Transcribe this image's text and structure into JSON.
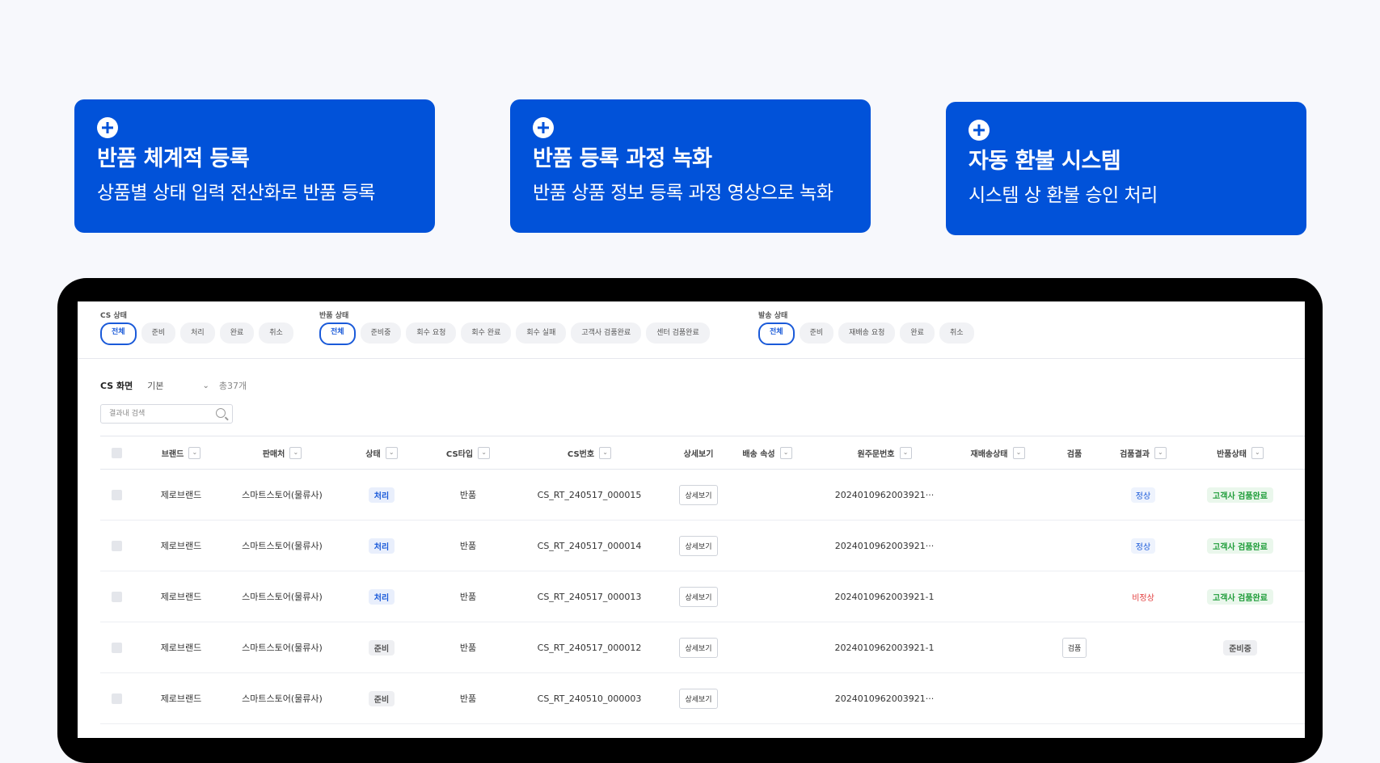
{
  "cards": [
    {
      "title": "반품 체계적 등록",
      "subtitle": "상품별 상태 입력 전산화로 반품 등록"
    },
    {
      "title": "반품 등록 과정 녹화",
      "subtitle": "반품 상품 정보 등록 과정 영상으로 녹화"
    },
    {
      "title": "자동 환불 시스템",
      "subtitle": "시스템 상 환불 승인 처리"
    }
  ],
  "filters": {
    "cs_status": {
      "label": "CS 상태",
      "options": [
        "전체",
        "준비",
        "처리",
        "완료",
        "취소"
      ],
      "selected": "전체"
    },
    "return_status": {
      "label": "반품 상태",
      "options": [
        "전체",
        "준비중",
        "회수 요청",
        "회수 완료",
        "회수 실패",
        "고객사 검품완료",
        "센터 검품완료"
      ],
      "selected": "전체"
    },
    "ship_status": {
      "label": "발송 상태",
      "options": [
        "전체",
        "준비",
        "재배송 요청",
        "완료",
        "취소"
      ],
      "selected": "전체"
    }
  },
  "view": {
    "title": "CS 화면",
    "mode": "기본",
    "total": "총37개"
  },
  "search": {
    "placeholder": "결과내 검색"
  },
  "table": {
    "headers": [
      "브랜드",
      "판매처",
      "상태",
      "CS타입",
      "CS번호",
      "상세보기",
      "배송 속성",
      "원주문번호",
      "재배송상태",
      "검품",
      "검품결과",
      "반품상태"
    ],
    "rows": [
      {
        "brand": "제로브랜드",
        "seller": "스마트스토어(물류사)",
        "status": "처리",
        "cs_type": "반품",
        "cs_no": "CS_RT_240517_000015",
        "detail": "상세보기",
        "order_no": "2024010962003921···",
        "inspect": "",
        "inspect_result": "정상",
        "return_status": "고객사 검품완료"
      },
      {
        "brand": "제로브랜드",
        "seller": "스마트스토어(물류사)",
        "status": "처리",
        "cs_type": "반품",
        "cs_no": "CS_RT_240517_000014",
        "detail": "상세보기",
        "order_no": "2024010962003921···",
        "inspect": "",
        "inspect_result": "정상",
        "return_status": "고객사 검품완료"
      },
      {
        "brand": "제로브랜드",
        "seller": "스마트스토어(물류사)",
        "status": "처리",
        "cs_type": "반품",
        "cs_no": "CS_RT_240517_000013",
        "detail": "상세보기",
        "order_no": "2024010962003921-1",
        "inspect": "",
        "inspect_result": "비정상",
        "return_status": "고객사 검품완료"
      },
      {
        "brand": "제로브랜드",
        "seller": "스마트스토어(물류사)",
        "status": "준비",
        "cs_type": "반품",
        "cs_no": "CS_RT_240517_000012",
        "detail": "상세보기",
        "order_no": "2024010962003921-1",
        "inspect": "검품",
        "inspect_result": "",
        "return_status": "준비중"
      },
      {
        "brand": "제로브랜드",
        "seller": "스마트스토어(물류사)",
        "status": "준비",
        "cs_type": "반품",
        "cs_no": "CS_RT_240510_000003",
        "detail": "상세보기",
        "order_no": "2024010962003921···",
        "inspect": "",
        "inspect_result": "",
        "return_status": ""
      }
    ]
  },
  "colors": {
    "accent": "#0152d9",
    "status_blue": "#1a5ad9",
    "status_green": "#1f9d3a",
    "status_red": "#e23b3b"
  }
}
